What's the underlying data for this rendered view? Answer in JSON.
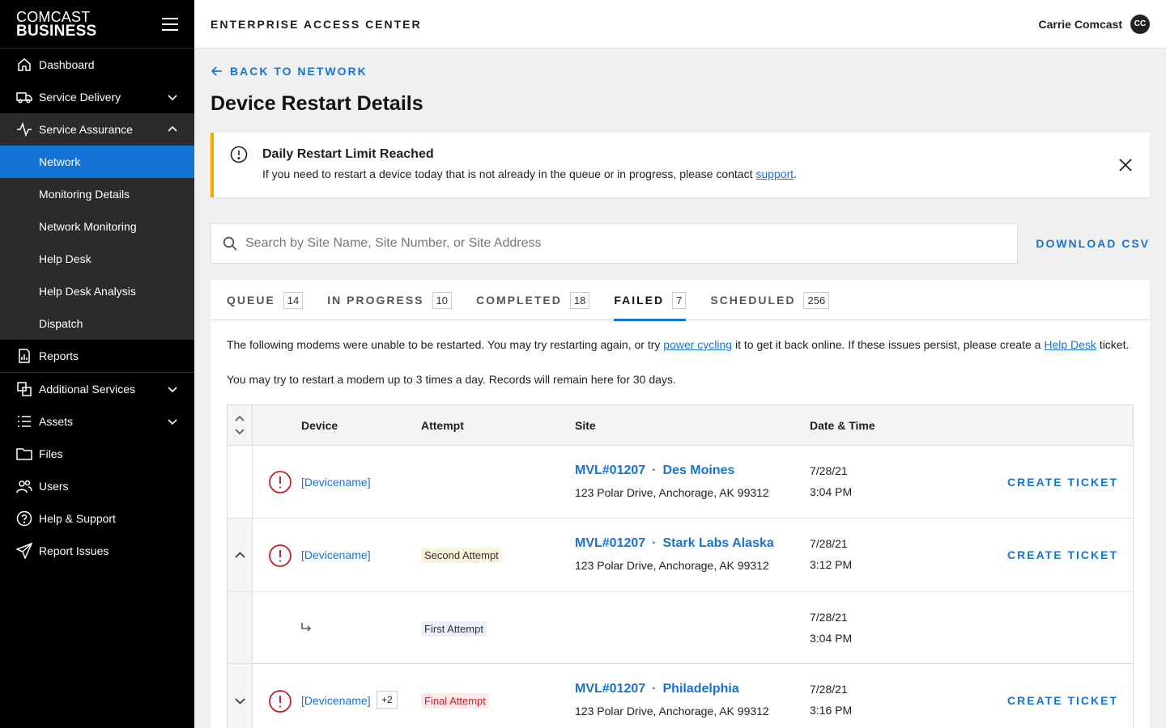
{
  "brand": {
    "line1": "COMCAST",
    "line2": "BUSINESS"
  },
  "sidebar": {
    "items": [
      {
        "label": "Dashboard",
        "icon": "home-icon"
      },
      {
        "label": "Service Delivery",
        "icon": "truck-icon"
      },
      {
        "label": "Service Assurance",
        "icon": "activity-icon"
      },
      {
        "label": "Reports",
        "icon": "report-icon"
      },
      {
        "label": "Additional Services",
        "icon": "copy-icon"
      },
      {
        "label": "Assets",
        "icon": "list-icon"
      },
      {
        "label": "Files",
        "icon": "folder-icon"
      },
      {
        "label": "Users",
        "icon": "users-icon"
      },
      {
        "label": "Help & Support",
        "icon": "help-icon"
      },
      {
        "label": "Report Issues",
        "icon": "send-icon"
      }
    ],
    "sub_items": [
      "Network",
      "Monitoring Details",
      "Network Monitoring",
      "Help Desk",
      "Help Desk Analysis",
      "Dispatch"
    ]
  },
  "header": {
    "title": "ENTERPRISE ACCESS CENTER",
    "user_name": "Carrie Comcast",
    "avatar_initials": "CC"
  },
  "main": {
    "back_label": "BACK TO NETWORK",
    "page_title": "Device Restart Details",
    "alert": {
      "title": "Daily Restart Limit Reached",
      "body_prefix": "If you need to restart a device today that is not already in the queue or in progress, please contact ",
      "body_link": "support",
      "body_suffix": "."
    },
    "search": {
      "placeholder": "Search by Site Name, Site Number, or Site Address"
    },
    "download_label": "DOWNLOAD CSV",
    "tabs": [
      {
        "label": "QUEUE",
        "count": "14"
      },
      {
        "label": "IN PROGRESS",
        "count": "10"
      },
      {
        "label": "COMPLETED",
        "count": "18"
      },
      {
        "label": "FAILED",
        "count": "7"
      },
      {
        "label": "SCHEDULED",
        "count": "256"
      }
    ],
    "desc1": {
      "p1": "The following modems were unable to be restarted. You may try restarting again, or try ",
      "link1": "power cycling",
      "p2": " it to get it back online. If these issues persist, please create a ",
      "link2": "Help Desk",
      "p3": " ticket."
    },
    "desc2": "You may try to restart a modem up to 3 times a day. Records will remain here for 30 days.",
    "table": {
      "headers": {
        "device": "Device",
        "attempt": "Attempt",
        "site": "Site",
        "datetime": "Date & Time"
      },
      "rows": [
        {
          "device": "[Devicename]",
          "attempt": "",
          "site_number": "MVL#01207",
          "dot": "·",
          "site_name": "Des Moines",
          "address": "123 Polar Drive, Anchorage, AK 99312",
          "date": "7/28/21",
          "time": "3:04 PM",
          "action": "CREATE TICKET"
        },
        {
          "device": "[Devicename]",
          "attempt": "Second Attempt",
          "site_number": "MVL#01207",
          "dot": "·",
          "site_name": "Stark Labs Alaska",
          "address": "123 Polar Drive, Anchorage, AK 99312",
          "date": "7/28/21",
          "time": "3:12 PM",
          "action": "CREATE TICKET"
        },
        {
          "attempt": "First Attempt",
          "date": "7/28/21",
          "time": "3:04 PM"
        },
        {
          "device": "[Devicename]",
          "extra": "+2",
          "attempt": "Final Attempt",
          "site_number": "MVL#01207",
          "dot": "·",
          "site_name": "Philadelphia",
          "address": "123 Polar Drive, Anchorage, AK 99312",
          "date": "7/28/21",
          "time": "3:16 PM",
          "action": "CREATE TICKET"
        }
      ]
    }
  },
  "colors": {
    "accent": "#1673d6",
    "warning": "#f2a900",
    "error": "#c9202b",
    "sidebar": "#000000"
  }
}
